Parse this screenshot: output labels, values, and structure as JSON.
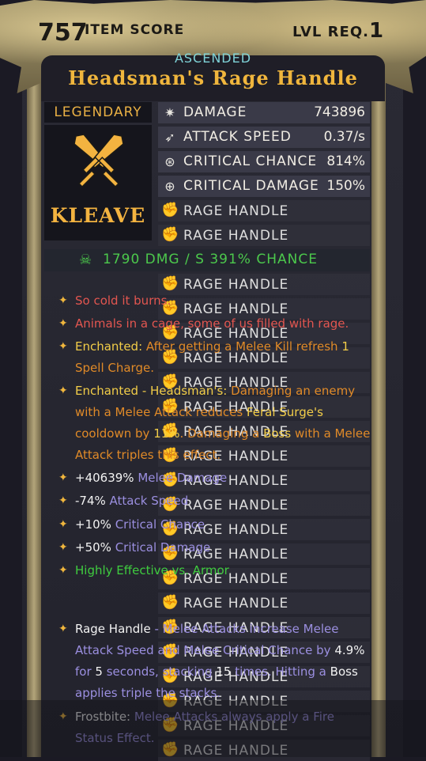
{
  "header": {
    "item_score_value": "757",
    "item_score_label": "ITEM SCORE",
    "level_req_label": "LVL REQ.",
    "level_req_value": "1"
  },
  "item": {
    "tier": "ASCENDED",
    "name": "Headsman's Rage Handle",
    "rarity": "LEGENDARY",
    "brand": "KLEAVE",
    "icon": "crossed-swords-icon"
  },
  "stats": [
    {
      "icon": "damage-icon",
      "name": "DAMAGE",
      "value": "743896"
    },
    {
      "icon": "attack-speed-icon",
      "name": "ATTACK SPEED",
      "value": "0.37/s"
    },
    {
      "icon": "crit-chance-icon",
      "name": "CRITICAL CHANCE",
      "value": "814%"
    },
    {
      "icon": "crit-damage-icon",
      "name": "CRITICAL DAMAGE",
      "value": "150%"
    }
  ],
  "rage_label": "RAGE HANDLE",
  "dps_line": "1790 DMG / S  391% CHANCE",
  "affixes": {
    "a1": "So cold it burns.",
    "a2": "Animals in a cage, some of us filled with rage.",
    "a3_title": "Enchanted:",
    "a3_text1": "After getting a Melee Kill refresh",
    "a3_num": "1",
    "a3_text2": "Spell Charge.",
    "a4_title": "Enchanted - Headsman's:",
    "a4_text1": "Damaging an enemy",
    "a4_text2": "with a Melee Attack reduces",
    "a4_skill": "Feral Surge's",
    "a4_text3": "cooldown by",
    "a4_pct": "11%",
    "a4_text4": ". Damaging a",
    "a4_boss": "Boss",
    "a4_text5": "with a Melee",
    "a4_text6": "Attack triples this effect.",
    "s1_val": "+40639%",
    "s1_name": "Melee Damage",
    "s2_val": "-74%",
    "s2_name": "Attack Speed",
    "s3_val": "+10%",
    "s3_name": "Critical Chance",
    "s4_val": "+50%",
    "s4_name": "Critical Damage",
    "s5": "Highly Effective vs. Armor",
    "r_title": "Rage Handle",
    "r_text1": " - Melee Attacks increase Melee",
    "r_text2": "Attack Speed and Melee Critical Chance by",
    "r_pct": "4.9%",
    "r_text3": "for",
    "r_secs": "5",
    "r_text4": "seconds, stacking",
    "r_stacks": "15",
    "r_text5": "times. Hitting a",
    "r_boss": "Boss",
    "r_text6": "applies triple the stacks.",
    "f_title": "Frostbite:",
    "f_text1": "Melee Attacks always apply a Fire",
    "f_text2": "Status Effect."
  }
}
